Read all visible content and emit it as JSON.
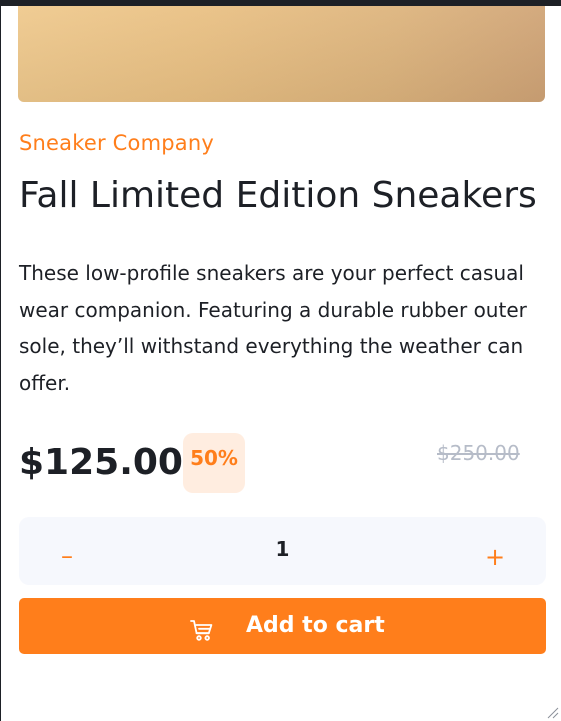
{
  "product": {
    "company": "Sneaker Company",
    "title": "Fall Limited Edition Sneakers",
    "description": "These low-profile sneakers are your perfect casual wear companion. Featuring a durable rubber outer sole, they’ll withstand everything the weather can offer.",
    "price": "$125.00",
    "discount": "50%",
    "original_price": "$250.00"
  },
  "cart": {
    "decrement_symbol": "–",
    "increment_symbol": "+",
    "quantity": "1",
    "add_button_label": "Add to cart",
    "add_button_icon": "cart-icon"
  },
  "colors": {
    "accent": "#ff7e1b",
    "accent_light": "#ffede0",
    "text_dark": "#1d2026",
    "text_muted": "#b6bcc8",
    "quantity_bg": "#f6f8fd"
  }
}
